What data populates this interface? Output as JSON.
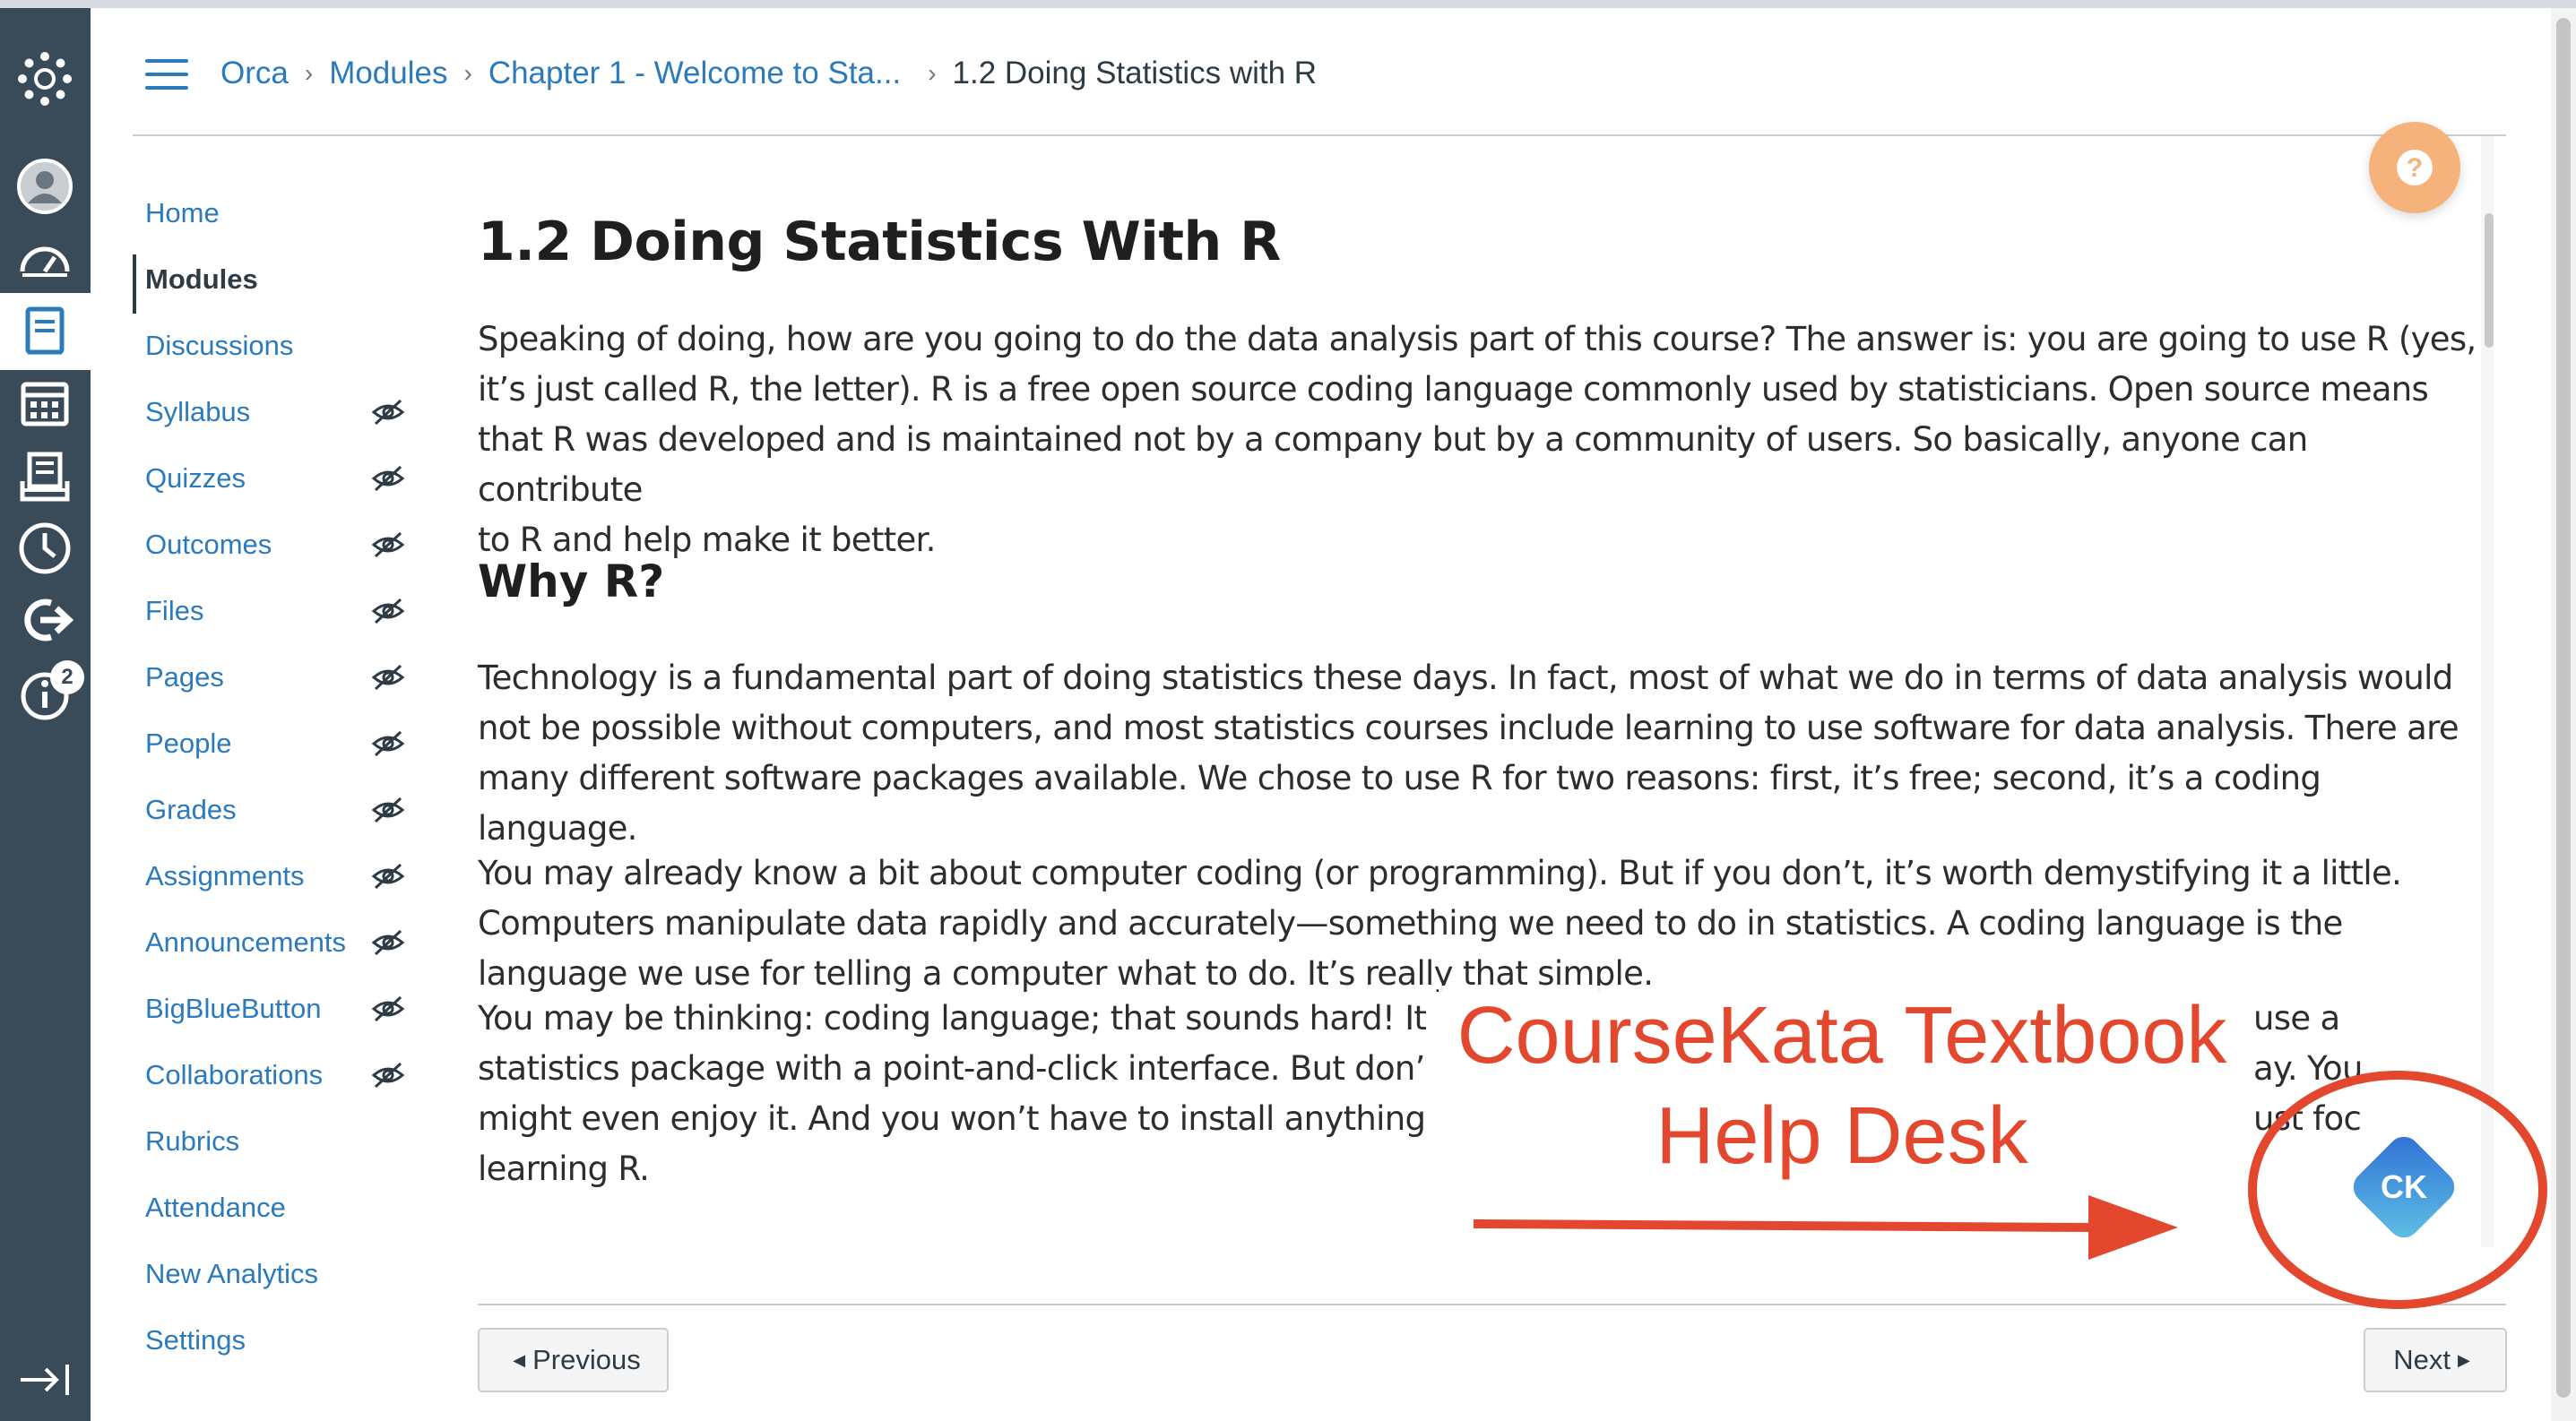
{
  "breadcrumb": {
    "items": [
      "Orca",
      "Modules",
      "Chapter 1 - Welcome to Sta...",
      "1.2 Doing Statistics with R"
    ]
  },
  "course_nav": {
    "items": [
      {
        "label": "Home"
      },
      {
        "label": "Modules",
        "active": true
      },
      {
        "label": "Discussions"
      },
      {
        "label": "Syllabus",
        "hidden": true
      },
      {
        "label": "Quizzes",
        "hidden": true
      },
      {
        "label": "Outcomes",
        "hidden": true
      },
      {
        "label": "Files",
        "hidden": true
      },
      {
        "label": "Pages",
        "hidden": true
      },
      {
        "label": "People",
        "hidden": true
      },
      {
        "label": "Grades",
        "hidden": true
      },
      {
        "label": "Assignments",
        "hidden": true
      },
      {
        "label": "Announcements",
        "hidden": true
      },
      {
        "label": "BigBlueButton",
        "hidden": true
      },
      {
        "label": "Collaborations",
        "hidden": true
      },
      {
        "label": "Rubrics"
      },
      {
        "label": "Attendance"
      },
      {
        "label": "New Analytics"
      },
      {
        "label": "Settings"
      }
    ]
  },
  "global_nav": {
    "icons": [
      "logo-icon",
      "account-icon",
      "dashboard-icon",
      "courses-icon",
      "calendar-icon",
      "inbox-icon",
      "history-icon",
      "commons-icon",
      "help-icon",
      "collapse-nav-icon"
    ],
    "help_badge": "2"
  },
  "content": {
    "title": "1.2 Doing Statistics With R",
    "paragraphs": [
      [
        "Speaking of doing, how are you going to do the data analysis part of this course? The answer is: you are going to use R (yes,",
        "it’s just called R, the letter). R is a free open source coding language commonly used by statisticians. Open source means",
        "that R was developed and is maintained not by a company but by a community of users. So basically, anyone can contribute",
        "to R and help make it better."
      ],
      [
        "Technology is a fundamental part of doing statistics these days. In fact, most of what we do in terms of data analysis would",
        "not be possible without computers, and most statistics courses include learning to use software for data analysis. There are",
        "many different software packages available. We chose to use R for two reasons: first, it’s free; second, it’s a coding language."
      ],
      [
        "You may already know a bit about computer coding (or programming). But if you don’t, it’s worth demystifying it a little.",
        "Computers manipulate data rapidly and accurately—something we need to do in statistics. A coding language is the",
        "language we use for telling a computer what to do. It’s really that simple."
      ],
      [
        "You may be thinking: coding language; that sounds hard! It",
        "statistics package with a point-and-click interface. But don’",
        "might even enjoy it. And you won’t have to install anything",
        "learning R."
      ]
    ],
    "para4_right_fragments": [
      "use a",
      "ay. You",
      "ust foc"
    ],
    "section_heading": "Why R?"
  },
  "footer": {
    "previous_label": "Previous",
    "next_label": "Next"
  },
  "annotation": {
    "lines": [
      "CourseKata Textbook",
      "Help Desk"
    ],
    "color": "#e3472d",
    "ck_label": "CK"
  },
  "colors": {
    "link": "#2b7abc",
    "global_nav_bg": "#394b58",
    "help_button": "#f6b27b",
    "ck_gradient_start": "#2f6fd6",
    "ck_gradient_end": "#5fc3e4"
  }
}
